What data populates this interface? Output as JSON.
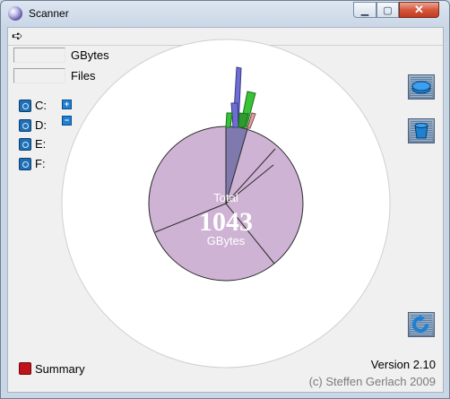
{
  "window": {
    "title": "Scanner"
  },
  "window_buttons": {
    "minimize": "▁",
    "maximize": "▢",
    "close": "✕"
  },
  "menu": {
    "arrow": "➪"
  },
  "stats": {
    "gbytes_label": "GBytes",
    "files_label": "Files",
    "gbytes_value": "",
    "files_value": ""
  },
  "drives": [
    {
      "label": "C:"
    },
    {
      "label": "D:"
    },
    {
      "label": "E:"
    },
    {
      "label": "F:"
    }
  ],
  "zoom": {
    "plus": "+",
    "minus": "−"
  },
  "toolbar": {
    "icons": [
      "scan-disk-icon",
      "bucket-icon",
      "refresh-icon"
    ]
  },
  "chart_data": {
    "type": "sunburst",
    "center_label": "Total",
    "center_value": "1043",
    "center_unit": "GBytes",
    "inner_ring_color": "#cfb3d4",
    "note": "Inner ring segments shown without labels"
  },
  "summary": {
    "label": "Summary"
  },
  "footer": {
    "version": "Version 2.10",
    "copyright": "(c) Steffen Gerlach 2009"
  }
}
